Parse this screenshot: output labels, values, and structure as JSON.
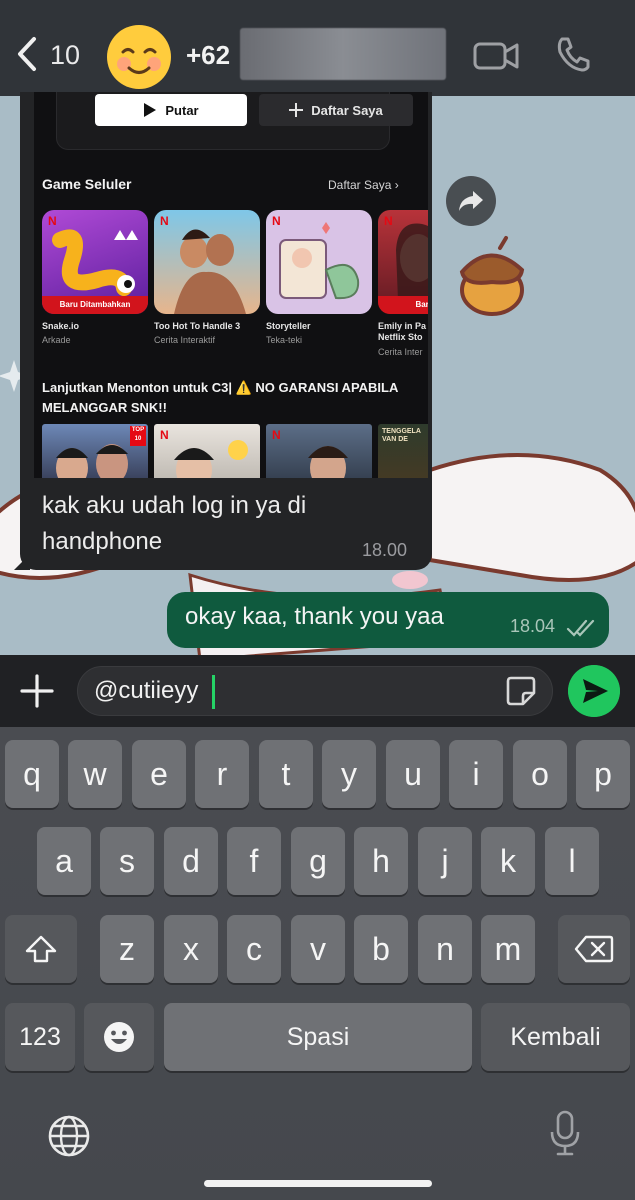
{
  "header": {
    "back_count": "10",
    "contact_name_visible": "+62",
    "avatar_emoji": "😊"
  },
  "incoming": {
    "screenshot": {
      "play_button": "Putar",
      "list_button": "Daftar Saya",
      "games_title": "Game Seluler",
      "games_link": "Daftar Saya",
      "games": [
        {
          "tag": "Baru Ditambahkan",
          "name": "Snake.io",
          "category": "Arkade"
        },
        {
          "tag": "",
          "name": "Too Hot To Handle 3",
          "category": "Cerita Interaktif"
        },
        {
          "tag": "",
          "name": "Storyteller",
          "category": "Teka-teki"
        },
        {
          "tag": "Baru Dit",
          "name": "Emily in Pa Netflix Sto",
          "category": "Cerita Inter"
        }
      ],
      "continue_title": "Lanjutkan Menonton untuk C3| ⚠️ NO GARANSI APABILA MELANGGAR SNK!!",
      "thumb_badge": "TOP 10",
      "thumb_last_text": "TENGGELA VAN DE"
    },
    "text": "kak aku udah log in ya di handphone",
    "time": "18.00"
  },
  "outgoing": {
    "text": "okay kaa, thank you yaa",
    "time": "18.04"
  },
  "composer": {
    "value": "@cutiieyy"
  },
  "keyboard": {
    "row1": [
      "q",
      "w",
      "e",
      "r",
      "t",
      "y",
      "u",
      "i",
      "o",
      "p"
    ],
    "row2": [
      "a",
      "s",
      "d",
      "f",
      "g",
      "h",
      "j",
      "k",
      "l"
    ],
    "row3": [
      "z",
      "x",
      "c",
      "v",
      "b",
      "n",
      "m"
    ],
    "numbers": "123",
    "space": "Spasi",
    "return": "Kembali"
  },
  "colors": {
    "accent_green": "#20c65e",
    "outgoing_bubble": "#0f5a3e",
    "incoming_bubble": "#232426",
    "netflix_red": "#e50914"
  }
}
